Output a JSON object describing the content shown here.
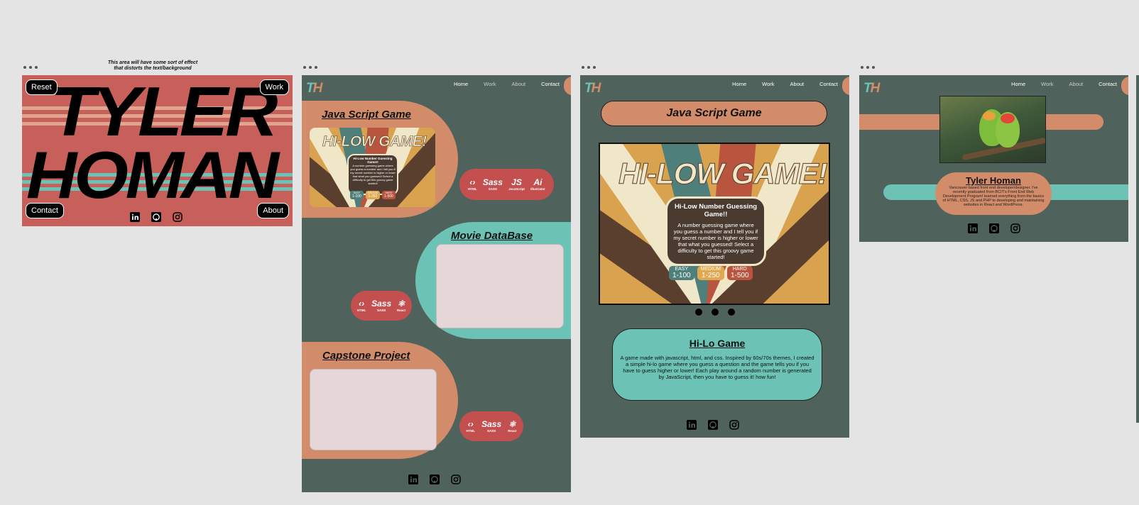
{
  "annotation": {
    "line1": "This area will have some sort of effect",
    "line2": "that distorts the text/background"
  },
  "landing": {
    "name_line1": "TYLER",
    "name_line2": "HOMAN",
    "reset_label": "Reset",
    "work_label": "Work",
    "contact_label": "Contact",
    "about_label": "About"
  },
  "nav": {
    "home": "Home",
    "work": "Work",
    "about": "About",
    "contact": "Contact"
  },
  "work_page": {
    "project1_title": "Java Script Game",
    "project2_title": "Movie DataBase",
    "project3_title": "Capstone Project",
    "stack1": [
      {
        "icon": "html-icon",
        "glyph": "‹›",
        "label": "HTML"
      },
      {
        "icon": "sass-icon",
        "glyph": "Sass",
        "label": "SASS"
      },
      {
        "icon": "javascript-icon",
        "glyph": "JS",
        "label": "JavaScript"
      },
      {
        "icon": "illustrator-icon",
        "glyph": "Ai",
        "label": "Illustrator"
      }
    ],
    "stack2": [
      {
        "icon": "html-icon",
        "glyph": "‹›",
        "label": "HTML"
      },
      {
        "icon": "sass-icon",
        "glyph": "Sass",
        "label": "SASS"
      },
      {
        "icon": "react-icon",
        "glyph": "⚛",
        "label": "React"
      }
    ],
    "stack3": [
      {
        "icon": "html-icon",
        "glyph": "‹›",
        "label": "HTML"
      },
      {
        "icon": "sass-icon",
        "glyph": "Sass",
        "label": "SASS"
      },
      {
        "icon": "react-icon",
        "glyph": "⚛",
        "label": "React"
      }
    ]
  },
  "game_art": {
    "headline": "HI-LOW GAME!",
    "box_title": "Hi-Low Number Guessing Game!!",
    "box_text": "A number guessing game where you guess a number and I tell you if my secret number is higher or lower that what you guessed! Select a difficulty to get this groovy game started!",
    "difficulties": [
      {
        "name": "EASY",
        "range": "1-100",
        "color": "#4f7f7a"
      },
      {
        "name": "MEDIUM",
        "range": "1-250",
        "color": "#d8a24f"
      },
      {
        "name": "HARD",
        "range": "1-500",
        "color": "#b9553f"
      }
    ]
  },
  "detail_page": {
    "title": "Java Script Game",
    "card_title": "Hi-Lo Game",
    "card_text": "A game made with javascript, html, and css. Inspired by 60s/70s themes, I created a simple hi-lo game where you guess a question and the game tells you if you have to guess higher or lower! Each play around a random number is generated by JavaScript, then you have to guess it! how fun!"
  },
  "about_page": {
    "name": "Tyler Homan",
    "bio": "Vancouver based front end developer/designer. I've recently graduated from BCIT's Front End Web Development Program! learned everything from the basics of HTML, CSS, JS and PHP to developing and maintaining websites in React and WordPress."
  },
  "social": [
    "linkedin-icon",
    "github-icon",
    "instagram-icon"
  ],
  "colors": {
    "background": "#e4e4e4",
    "landing_red": "#c75f5a",
    "dark_green": "#4f635c",
    "peach": "#d38c6a",
    "teal": "#6cc3b5",
    "pill_red": "#c44f4f"
  }
}
